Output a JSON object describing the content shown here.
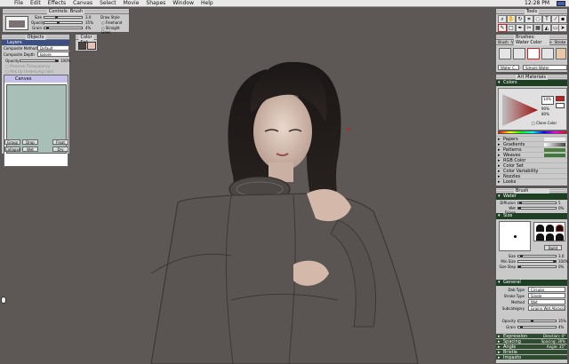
{
  "menubar": {
    "items": [
      "File",
      "Edit",
      "Effects",
      "Canvas",
      "Select",
      "Movie",
      "Shapes",
      "Window",
      "Help"
    ],
    "clock": "12:28 PM"
  },
  "brush_controls": {
    "title": "Controls: Brush",
    "size_label": "Size",
    "size_value": "3.0",
    "opacity_label": "Opacity",
    "opacity_value": "35%",
    "grain_label": "Grain",
    "grain_value": "4%",
    "draw_style_label": "Draw Style",
    "freehand_label": "Freehand",
    "straight_label": "Straight Lines",
    "size_fraction": 0.3,
    "opacity_fraction": 0.35,
    "grain_fraction": 0.04
  },
  "layers": {
    "title": "Objects",
    "tab": "Layers",
    "composite_method_label": "Composite Method",
    "composite_method_value": "Default",
    "composite_depth_label": "Composite Depth",
    "composite_depth_value": "Ignore",
    "opacity_label": "Opacity",
    "opacity_value": "100%",
    "preserve_label": "Preserve Transparency",
    "pick_label": "Pick Up Underlying Color",
    "canvas_layer": "Canvas",
    "buttons": [
      "Group",
      "Drop",
      "Float",
      "Collapse",
      "Wet",
      "Dry"
    ],
    "opacity_fraction": 1.0
  },
  "color_set": {
    "title": "Color Set"
  },
  "toolbox": {
    "title": "Tools",
    "icons": [
      "magnifier-icon",
      "hand-icon",
      "rotate-icon",
      "crop-icon",
      "lasso-icon",
      "text-icon",
      "eyedropper-icon",
      "dropper-icon",
      "brush-icon",
      "shape-icon",
      "pen-icon",
      "scissors-icon",
      "gradient-icon",
      "bucket-icon",
      "eraser-icon",
      "pointer-icon"
    ]
  },
  "brush_selector": {
    "title": "Brushes: Water Color",
    "tabs": [
      "Brush",
      "Variant",
      "Control",
      "Nozzle",
      "Stroke"
    ],
    "brush_name": "Water C...",
    "variant_name": "Simple Water"
  },
  "art_materials": {
    "title": "Art Materials",
    "colors_tab": "Colors",
    "h_value": "14%",
    "s_value": "90%",
    "v_value": "80%",
    "clone_color_label": "Clone Color",
    "list": [
      "Papers",
      "Gradients",
      "Patterns",
      "Weaves",
      "RGB Color",
      "Color Set",
      "Color Variability",
      "Nozzles",
      "Looks"
    ],
    "accent_color": "#d11a1a"
  },
  "brush_controls_panel": {
    "title": "Brush Controls",
    "water_section": "Water",
    "diffusion_label": "Diffusion",
    "diffusion_value": "5",
    "wet_fringe_label": "Wet Fringe",
    "wet_fringe_value": "0%",
    "size_section": "Size",
    "size_label": "Size",
    "size_value": "3.0",
    "min_size_label": "Min Size",
    "min_size_value": "100%",
    "size_step_label": "Size Step",
    "size_step_value": "0%",
    "build_label": "Build",
    "general_section": "General",
    "dab_type_label": "Dab Type",
    "dab_type_value": "Circular",
    "stroke_type_label": "Stroke Type",
    "stroke_type_value": "Single",
    "method_label": "Method",
    "method_value": "Wet",
    "subcategory_label": "Subcategory",
    "subcategory_value": "Grainy Wet Abrasion",
    "opacity_label": "Opacity",
    "opacity_value": "35%",
    "grain_label": "Grain",
    "grain_value": "4%",
    "collapsed": [
      {
        "name": "Expression",
        "detail": "Direction: 0°"
      },
      {
        "name": "Spacing",
        "detail": "Spacing: 36%"
      },
      {
        "name": "Angle",
        "detail": "Angle: 35°"
      },
      {
        "name": "Bristle",
        "detail": ""
      },
      {
        "name": "Impasto",
        "detail": ""
      }
    ],
    "diffusion_fraction": 0.05,
    "size_fraction": 0.03,
    "min_size_fraction": 1.0,
    "opacity_fraction": 0.35,
    "grain_fraction": 0.04
  }
}
